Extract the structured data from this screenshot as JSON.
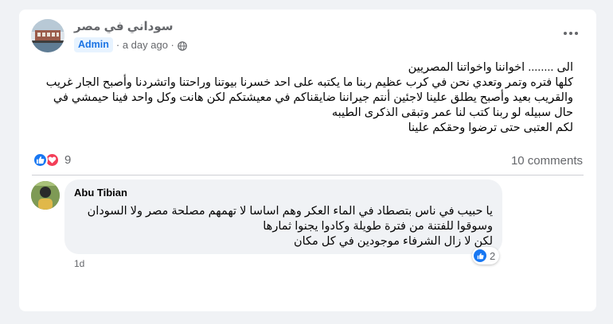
{
  "post": {
    "group_name": "سوداني في مصر",
    "role_badge": "Admin",
    "time": "· a day ago ·",
    "body_lines": [
      "الى ........ اخواننا واخواتنا المصريين",
      "كلها فتره وتمر وتعدي نحن في كرب عظيم ربنا ما يكتبه على احد خسرنا بيوتنا وراحتنا واتشردنا وأصبح الجار غريب",
      "والقريب بعيد وأصبح يطلق علينا لاجئين  أنتم جيراننا ضايقناكم في معيشتكم لكن هانت وكل واحد فينا حيمشي في",
      "حال سبيله لو ربنا كتب لنا عمر وتبقى الذكرى الطيبه",
      "لكم العتبى حتى ترضوا وحقكم علينا"
    ],
    "reaction_count": "9",
    "comments_count": "10 comments"
  },
  "comment": {
    "author": "Abu Tibian",
    "lines": [
      "يا حبيب في ناس بتصطاد في الماء العكر وهم اساسا لا تهمهم مصلحة مصر ولا السودان",
      "وسوقوا للفتنة من فترة طويلة وكادوا يجنوا ثمارها",
      "لكن لا زال الشرفاء موجودين في كل مكان"
    ],
    "reaction_count": "2",
    "time": "1d"
  },
  "icons": {
    "privacy": "globe-icon",
    "more": "more-dots-icon",
    "like": "like-reaction-icon",
    "love": "love-reaction-icon"
  },
  "colors": {
    "accent": "#1877f2",
    "badge_bg": "#e7f3ff",
    "badge_text": "#1b74e4",
    "love": "#f33e58",
    "secondary_text": "#65676b",
    "bubble_bg": "#f0f2f5"
  }
}
